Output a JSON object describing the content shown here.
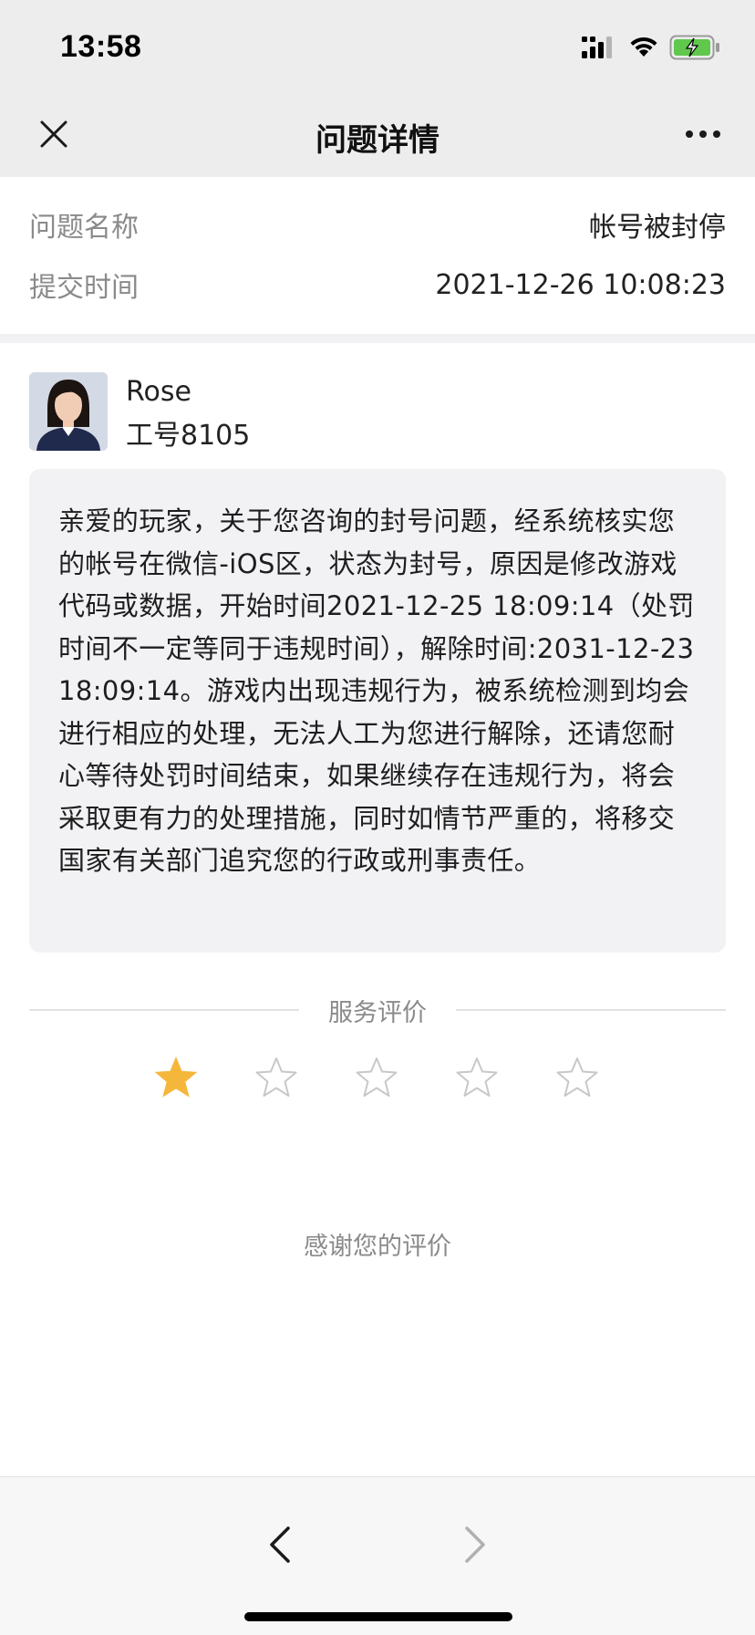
{
  "status_bar": {
    "time": "13:58"
  },
  "nav": {
    "title": "问题详情"
  },
  "info": {
    "rows": [
      {
        "label": "问题名称",
        "value": "帐号被封停"
      },
      {
        "label": "提交时间",
        "value": "2021-12-26 10:08:23"
      }
    ]
  },
  "agent": {
    "name": "Rose",
    "employee_id": "工号8105"
  },
  "message": {
    "text": "亲爱的玩家，关于您咨询的封号问题，经系统核实您的帐号在微信-iOS区，状态为封号，原因是修改游戏代码或数据，开始时间2021-12-25 18:09:14（处罚时间不一定等同于违规时间），解除时间:2031-12-23 18:09:14。游戏内出现违规行为，被系统检测到均会进行相应的处理，无法人工为您进行解除，还请您耐心等待处罚时间结束，如果继续存在违规行为，将会采取更有力的处理措施，同时如情节严重的，将移交国家有关部门追究您的行政或刑事责任。"
  },
  "rating": {
    "title": "服务评价",
    "value": 1,
    "max": 5,
    "filled_color": "#f5b73b",
    "empty_color": "#c8c8c8",
    "thanks": "感谢您的评价"
  },
  "icons": {
    "close": "close-icon",
    "more": "more-icon",
    "back": "chevron-left-icon",
    "forward": "chevron-right-icon",
    "star": "star-icon"
  }
}
